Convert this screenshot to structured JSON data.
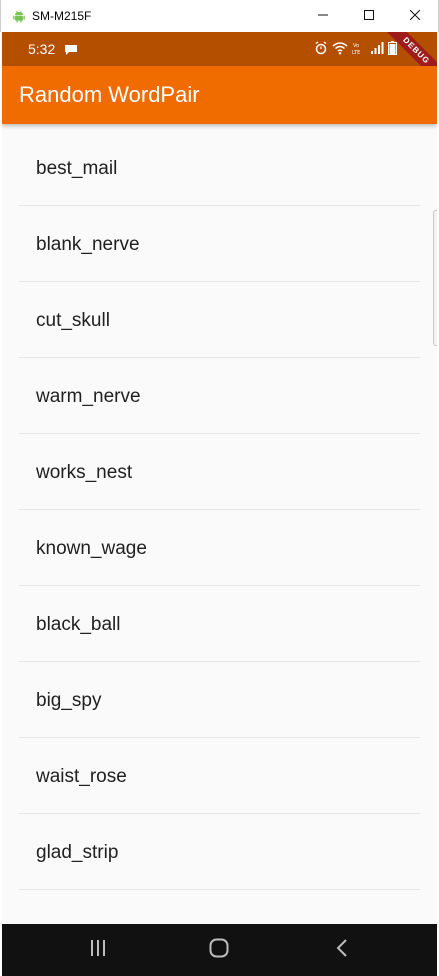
{
  "window": {
    "title": "SM-M215F",
    "app_icon": "android-icon",
    "controls": [
      "minimize-icon",
      "maximize-icon",
      "close-icon"
    ]
  },
  "status_bar": {
    "time": "5:32",
    "indicators": [
      "alarm-icon",
      "wifi-icon",
      "volte-icon",
      "signal-icon",
      "battery-icon"
    ],
    "color": "#b54f00"
  },
  "debug_banner": {
    "label": "DEBUG"
  },
  "app_bar": {
    "title": "Random WordPair",
    "color": "#f06b00"
  },
  "word_pairs": [
    "best_mail",
    "blank_nerve",
    "cut_skull",
    "warm_nerve",
    "works_nest",
    "known_wage",
    "black_ball",
    "big_spy",
    "waist_rose",
    "glad_strip"
  ],
  "nav_bar": {
    "buttons": [
      "recents-icon",
      "home-icon",
      "back-icon"
    ]
  }
}
